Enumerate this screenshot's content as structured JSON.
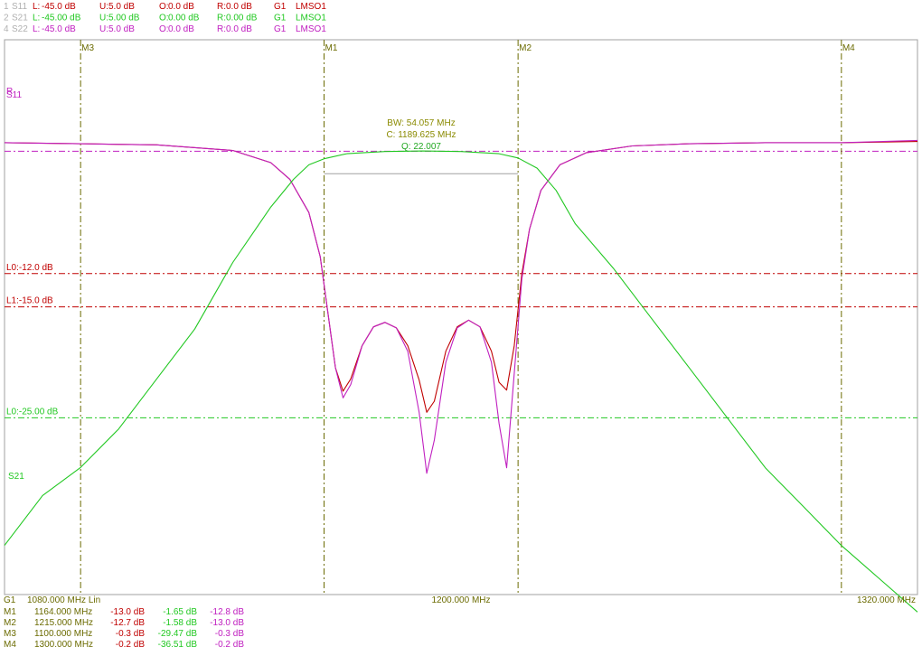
{
  "colors": {
    "s11": "#c00000",
    "s21": "#22c822",
    "s22": "#c020c0",
    "marker": "#6b6b00",
    "grey": "#a0a0a0",
    "limit_red": "#c00000",
    "ref_magenta": "#c020c0"
  },
  "header": {
    "rows": [
      {
        "id": "1",
        "trace": "S11",
        "L": "-45.0 dB",
        "U": "5.0 dB",
        "O": "0.0 dB",
        "R": "0.0 dB",
        "G": "G1",
        "mem": "LMSO1",
        "color": "#c00000"
      },
      {
        "id": "2",
        "trace": "S21",
        "L": "-45.00 dB",
        "U": "5.00 dB",
        "O": "0.00 dB",
        "R": "0.00 dB",
        "G": "G1",
        "mem": "LMSO1",
        "color": "#22c822"
      },
      {
        "id": "4",
        "trace": "S22",
        "L": "-45.0 dB",
        "U": "5.0 dB",
        "O": "0.0 dB",
        "R": "0.0 dB",
        "G": "G1",
        "mem": "LMSO1",
        "color": "#c020c0"
      }
    ]
  },
  "chart_data": {
    "type": "line",
    "x_unit": "MHz",
    "xlim": [
      1080,
      1320
    ],
    "ylim": [
      -45,
      5
    ],
    "markers": [
      {
        "name": "M1",
        "x": 1164
      },
      {
        "name": "M2",
        "x": 1215
      },
      {
        "name": "M3",
        "x": 1100
      },
      {
        "name": "M4",
        "x": 1300
      }
    ],
    "limit_lines": [
      {
        "label": "L0:-12.0 dB",
        "y": -12.0,
        "color": "#c00000"
      },
      {
        "label": "L1:-15.0 dB",
        "y": -15.0,
        "color": "#c00000"
      },
      {
        "label": "L0:-25.00 dB",
        "y": -25.0,
        "color": "#22c822"
      }
    ],
    "ref_label": "R",
    "trace_labels": [
      {
        "text": "S11",
        "color": "#c020c0"
      },
      {
        "text": "S21",
        "color": "#22c822"
      }
    ],
    "bandwidth": {
      "bw": "BW:  54.057 MHz",
      "center": "C: 1189.625 MHz",
      "q": "Q: 22.007"
    },
    "series": [
      {
        "name": "S11",
        "color": "#c00000",
        "points": [
          [
            1080,
            -0.2
          ],
          [
            1100,
            -0.3
          ],
          [
            1120,
            -0.4
          ],
          [
            1140,
            -0.9
          ],
          [
            1150,
            -2.0
          ],
          [
            1155,
            -3.5
          ],
          [
            1160,
            -6.5
          ],
          [
            1163,
            -10.5
          ],
          [
            1165,
            -15.5
          ],
          [
            1167,
            -20.5
          ],
          [
            1169,
            -22.6
          ],
          [
            1171,
            -21.5
          ],
          [
            1174,
            -18.5
          ],
          [
            1177,
            -16.8
          ],
          [
            1180,
            -16.4
          ],
          [
            1183,
            -16.9
          ],
          [
            1186,
            -18.5
          ],
          [
            1189,
            -21.6
          ],
          [
            1191,
            -24.5
          ],
          [
            1193,
            -23.5
          ],
          [
            1196,
            -19.0
          ],
          [
            1199,
            -16.8
          ],
          [
            1202,
            -16.2
          ],
          [
            1205,
            -16.8
          ],
          [
            1208,
            -19.0
          ],
          [
            1210,
            -21.8
          ],
          [
            1212,
            -22.5
          ],
          [
            1214,
            -18.5
          ],
          [
            1216,
            -12.0
          ],
          [
            1218,
            -8.0
          ],
          [
            1221,
            -4.5
          ],
          [
            1226,
            -2.2
          ],
          [
            1233,
            -1.1
          ],
          [
            1245,
            -0.5
          ],
          [
            1260,
            -0.3
          ],
          [
            1280,
            -0.2
          ],
          [
            1300,
            -0.2
          ],
          [
            1320,
            -0.1
          ]
        ]
      },
      {
        "name": "S22",
        "color": "#c020c0",
        "points": [
          [
            1080,
            -0.2
          ],
          [
            1100,
            -0.3
          ],
          [
            1120,
            -0.4
          ],
          [
            1140,
            -0.9
          ],
          [
            1150,
            -2.0
          ],
          [
            1155,
            -3.5
          ],
          [
            1160,
            -6.5
          ],
          [
            1163,
            -10.5
          ],
          [
            1165,
            -15.5
          ],
          [
            1167,
            -20.5
          ],
          [
            1169,
            -23.2
          ],
          [
            1171,
            -22.0
          ],
          [
            1174,
            -18.5
          ],
          [
            1177,
            -16.8
          ],
          [
            1180,
            -16.4
          ],
          [
            1183,
            -16.9
          ],
          [
            1186,
            -19.0
          ],
          [
            1189,
            -24.5
          ],
          [
            1191,
            -30.0
          ],
          [
            1193,
            -27.0
          ],
          [
            1196,
            -20.0
          ],
          [
            1199,
            -16.9
          ],
          [
            1202,
            -16.2
          ],
          [
            1205,
            -16.8
          ],
          [
            1208,
            -20.0
          ],
          [
            1210,
            -25.5
          ],
          [
            1212,
            -29.5
          ],
          [
            1214,
            -21.0
          ],
          [
            1216,
            -12.5
          ],
          [
            1218,
            -8.0
          ],
          [
            1221,
            -4.5
          ],
          [
            1226,
            -2.2
          ],
          [
            1233,
            -1.1
          ],
          [
            1245,
            -0.5
          ],
          [
            1260,
            -0.3
          ],
          [
            1280,
            -0.2
          ],
          [
            1300,
            -0.2
          ],
          [
            1320,
            0.0
          ]
        ]
      },
      {
        "name": "S21",
        "color": "#22c822",
        "points": [
          [
            1080,
            -36.5
          ],
          [
            1090,
            -32.0
          ],
          [
            1100,
            -29.47
          ],
          [
            1110,
            -26.0
          ],
          [
            1120,
            -21.5
          ],
          [
            1130,
            -17.0
          ],
          [
            1140,
            -11.0
          ],
          [
            1150,
            -6.0
          ],
          [
            1156,
            -3.5
          ],
          [
            1160,
            -2.2
          ],
          [
            1164,
            -1.65
          ],
          [
            1170,
            -1.2
          ],
          [
            1180,
            -1.0
          ],
          [
            1190,
            -0.95
          ],
          [
            1200,
            -1.0
          ],
          [
            1210,
            -1.2
          ],
          [
            1215,
            -1.58
          ],
          [
            1220,
            -2.5
          ],
          [
            1225,
            -4.5
          ],
          [
            1230,
            -7.5
          ],
          [
            1240,
            -11.5
          ],
          [
            1250,
            -16.0
          ],
          [
            1260,
            -20.5
          ],
          [
            1270,
            -25.0
          ],
          [
            1280,
            -29.5
          ],
          [
            1290,
            -33.0
          ],
          [
            1300,
            -36.51
          ],
          [
            1310,
            -39.5
          ],
          [
            1320,
            -42.5
          ]
        ]
      }
    ]
  },
  "footer": {
    "g1": "G1",
    "start": "1080.000 MHz  Lin",
    "center": "1200.000 MHz",
    "stop": "1320.000 MHz",
    "marker_rows": [
      {
        "name": "M1",
        "freq": "1164.000 MHz",
        "s11": "-13.0 dB",
        "s21": "-1.65 dB",
        "s22": "-12.8 dB"
      },
      {
        "name": "M2",
        "freq": "1215.000 MHz",
        "s11": "-12.7 dB",
        "s21": "-1.58 dB",
        "s22": "-13.0 dB"
      },
      {
        "name": "M3",
        "freq": "1100.000 MHz",
        "s11": "-0.3 dB",
        "s21": "-29.47 dB",
        "s22": "-0.3 dB"
      },
      {
        "name": "M4",
        "freq": "1300.000 MHz",
        "s11": "-0.2 dB",
        "s21": "-36.51 dB",
        "s22": "-0.2 dB"
      }
    ]
  }
}
